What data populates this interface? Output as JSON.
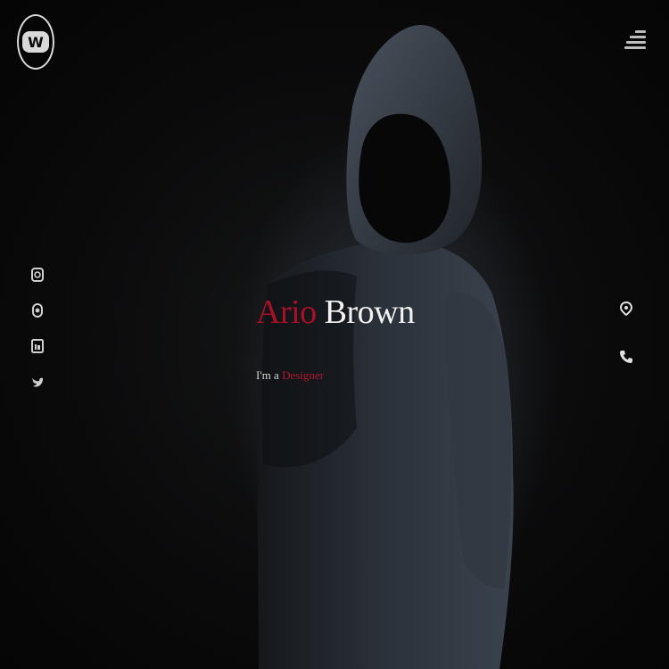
{
  "brand": {
    "logo_letter": "W"
  },
  "header": {
    "menu_icon": "menu-lines-icon"
  },
  "hero": {
    "first_name": "Ario",
    "last_name": "Brown",
    "tagline_lead": "I'm a",
    "tagline_role": "Designer",
    "accent_color": "#a8102a"
  },
  "social_links": [
    {
      "icon": "dribbble-icon"
    },
    {
      "icon": "instagram-icon"
    },
    {
      "icon": "linkedin-icon"
    },
    {
      "icon": "twitter-icon"
    }
  ],
  "contact_links": [
    {
      "icon": "location-pin-icon"
    },
    {
      "icon": "phone-icon"
    }
  ]
}
